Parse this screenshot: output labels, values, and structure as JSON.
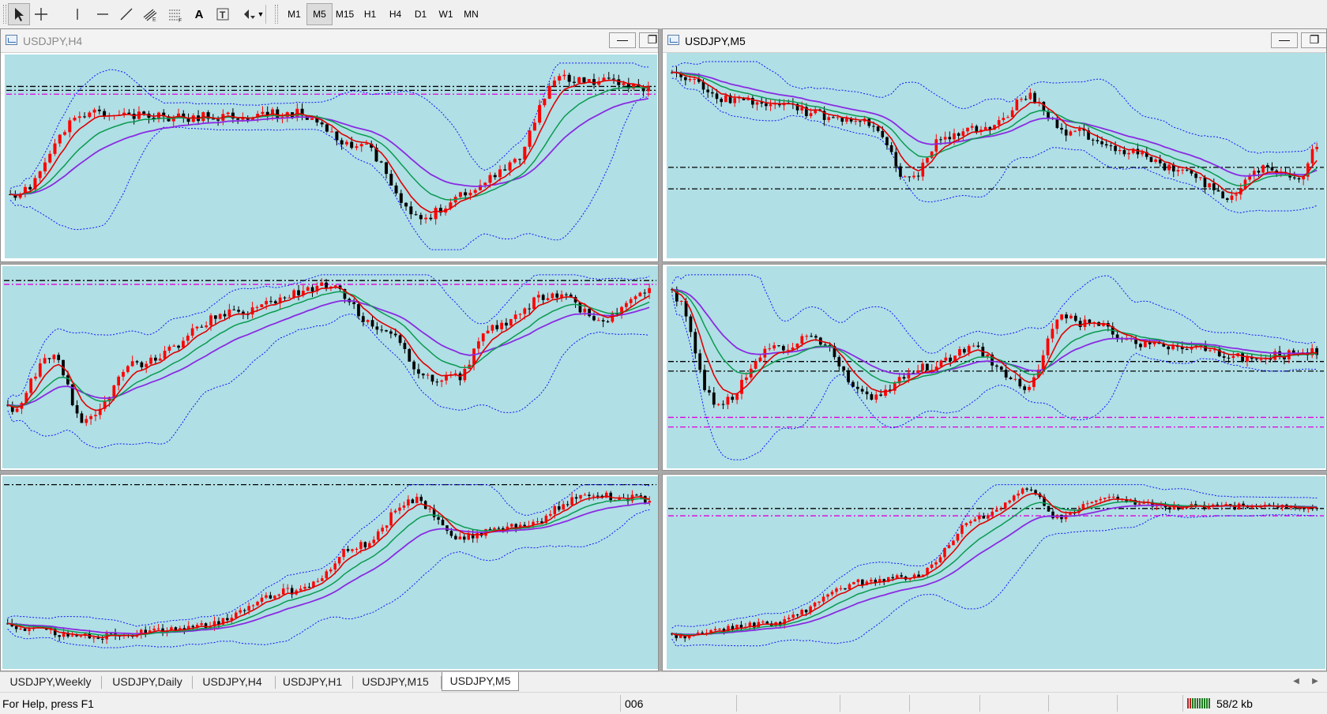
{
  "toolbar": {
    "tools": [
      {
        "icon": "cursor-icon",
        "active": true
      },
      {
        "icon": "crosshair-icon",
        "active": false
      },
      {
        "icon": "vertical-line-icon",
        "active": false
      },
      {
        "icon": "horizontal-line-icon",
        "active": false
      },
      {
        "icon": "trendline-icon",
        "active": false
      },
      {
        "icon": "equidistant-channel-icon",
        "active": false
      },
      {
        "icon": "fibonacci-icon",
        "active": false
      },
      {
        "icon": "text-icon",
        "active": false
      },
      {
        "icon": "text-label-icon",
        "active": false
      },
      {
        "icon": "arrows-dropdown-icon",
        "active": false
      }
    ],
    "text_tool_label": "A",
    "timeframes": [
      "M1",
      "M5",
      "M15",
      "H1",
      "H4",
      "D1",
      "W1",
      "MN"
    ],
    "active_timeframe": "M5"
  },
  "windows": [
    {
      "title": "USDJPY,H4",
      "active": false,
      "minimize_glyph": "—"
    },
    {
      "title": "USDJPY,M5",
      "active": true,
      "minimize_glyph": "—"
    }
  ],
  "tabs": [
    "USDJPY,Weekly",
    "USDJPY,Daily",
    "USDJPY,H4",
    "USDJPY,H1",
    "USDJPY,M15",
    "USDJPY,M5"
  ],
  "active_tab": "USDJPY,M5",
  "status": {
    "help": "For Help, press F1",
    "profile": "006",
    "traffic": "58/2 kb"
  },
  "colors": {
    "plot_bg": "#b0dfe5",
    "bull": "#ff0000",
    "bear": "#000000",
    "ma_fast": "#e00000",
    "ma_mid": "#0a9a50",
    "ma_slow": "#8a2be2",
    "band": "#1414ff",
    "level_black": "#000000",
    "level_magenta": "#e000e0"
  }
}
